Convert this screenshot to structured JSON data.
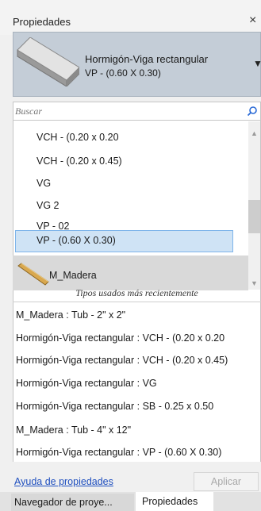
{
  "panel": {
    "title": "Propiedades",
    "close_glyph": "×"
  },
  "type_selector": {
    "family": "Hormigón-Viga rectangular",
    "type": "VP - (0.60 X 0.30)",
    "preview_icon": "concrete-beam-icon",
    "dropdown_icon": "dropdown-arrow-icon"
  },
  "search": {
    "placeholder": "Buscar",
    "icon": "search-icon"
  },
  "type_list": {
    "items": [
      "VCH - (0.20 x 0.20",
      "VCH - (0.20 x 0.45)",
      "VG",
      "VG 2",
      "VP - 02",
      "VP - (0.60 X 0.30)"
    ],
    "selected_index": 5,
    "family_group": {
      "label": "M_Madera",
      "icon": "wood-beam-icon"
    }
  },
  "recent": {
    "header": "Tipos usados más recientemente",
    "items": [
      "M_Madera : Tub - 2\" x 2\"",
      "Hormigón-Viga rectangular : VCH - (0.20 x 0.20",
      "Hormigón-Viga rectangular : VCH - (0.20 x 0.45)",
      "Hormigón-Viga rectangular : VG",
      "Hormigón-Viga rectangular : SB - 0.25 x 0.50",
      "M_Madera : Tub - 4\" x 12\"",
      "Hormigón-Viga rectangular : VP - (0.60 X 0.30)"
    ]
  },
  "footer": {
    "help_link": "Ayuda de propiedades",
    "apply_label": "Aplicar"
  },
  "tabs": [
    {
      "label": "Navegador de proye..."
    },
    {
      "label": "Propiedades",
      "active": true
    }
  ],
  "colors": {
    "accent": "#7eb4ea",
    "selection": "#cfe3f5",
    "header_bg": "#c4cdd7",
    "link": "#1f4fbf"
  }
}
